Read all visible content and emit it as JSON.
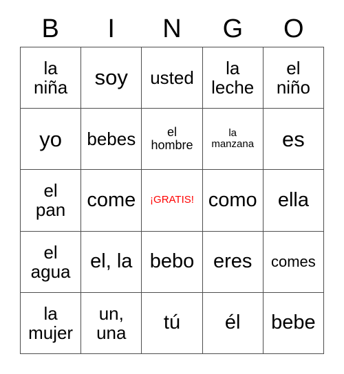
{
  "card": {
    "title_letters": [
      "B",
      "I",
      "N",
      "G",
      "O"
    ],
    "free_space_color": "#ff0000",
    "grid_line_color": "#4d4d4d",
    "background_color": "#ffffff",
    "rows": 5,
    "columns": 5,
    "cells": [
      [
        {
          "text": "la\nniña",
          "size": "l",
          "free": false
        },
        {
          "text": "soy",
          "size": "xxl",
          "free": false
        },
        {
          "text": "usted",
          "size": "l",
          "free": false
        },
        {
          "text": "la\nleche",
          "size": "l",
          "free": false
        },
        {
          "text": "el\nniño",
          "size": "l",
          "free": false
        }
      ],
      [
        {
          "text": "yo",
          "size": "xxl",
          "free": false
        },
        {
          "text": "bebes",
          "size": "l",
          "free": false
        },
        {
          "text": "el\nhombre",
          "size": "s",
          "free": false
        },
        {
          "text": "la\nmanzana",
          "size": "xs",
          "free": false
        },
        {
          "text": "es",
          "size": "xxl",
          "free": false
        }
      ],
      [
        {
          "text": "el\npan",
          "size": "l",
          "free": false
        },
        {
          "text": "come",
          "size": "xl",
          "free": false
        },
        {
          "text": "¡GRATIS!",
          "size": "xs",
          "free": true
        },
        {
          "text": "como",
          "size": "xl",
          "free": false
        },
        {
          "text": "ella",
          "size": "xl",
          "free": false
        }
      ],
      [
        {
          "text": "el\nagua",
          "size": "l",
          "free": false
        },
        {
          "text": "el, la",
          "size": "xl",
          "free": false
        },
        {
          "text": "bebo",
          "size": "xl",
          "free": false
        },
        {
          "text": "eres",
          "size": "xl",
          "free": false
        },
        {
          "text": "comes",
          "size": "m",
          "free": false
        }
      ],
      [
        {
          "text": "la\nmujer",
          "size": "l",
          "free": false
        },
        {
          "text": "un,\nuna",
          "size": "l",
          "free": false
        },
        {
          "text": "tú",
          "size": "xl",
          "free": false
        },
        {
          "text": "él",
          "size": "xl",
          "free": false
        },
        {
          "text": "bebe",
          "size": "xl",
          "free": false
        }
      ]
    ]
  }
}
